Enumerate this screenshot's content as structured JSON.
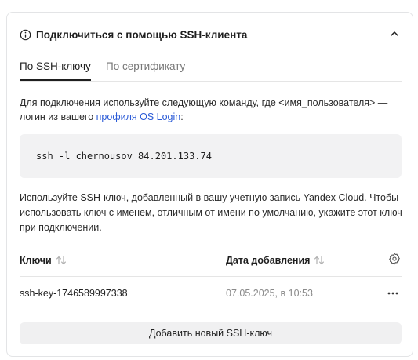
{
  "header": {
    "title": "Подключиться с помощью SSH-клиента"
  },
  "tabs": [
    {
      "label": "По SSH-ключу",
      "active": true
    },
    {
      "label": "По сертификату",
      "active": false
    }
  ],
  "description": {
    "text_before_link": "Для подключения используйте следующую команду, где <имя_пользователя> — логин из вашего ",
    "link_text": "профиля OS Login",
    "text_after_link": ":"
  },
  "command": "ssh -l chernousov 84.201.133.74",
  "info": "Используйте SSH-ключ, добавленный в вашу учетную запись Yandex Cloud. Чтобы использовать ключ с именем, отличным от имени по умолчанию, укажите этот ключ при подключении.",
  "table": {
    "columns": [
      "Ключи",
      "Дата добавления"
    ],
    "rows": [
      {
        "key": "ssh-key-1746589997338",
        "date": "07.05.2025, в 10:53"
      }
    ]
  },
  "add_button_label": "Добавить новый SSH-ключ",
  "colors": {
    "link": "#2b5bd7",
    "muted": "#8a8a8a",
    "button_bg": "#f0f0f1",
    "code_bg": "#f2f2f3"
  }
}
